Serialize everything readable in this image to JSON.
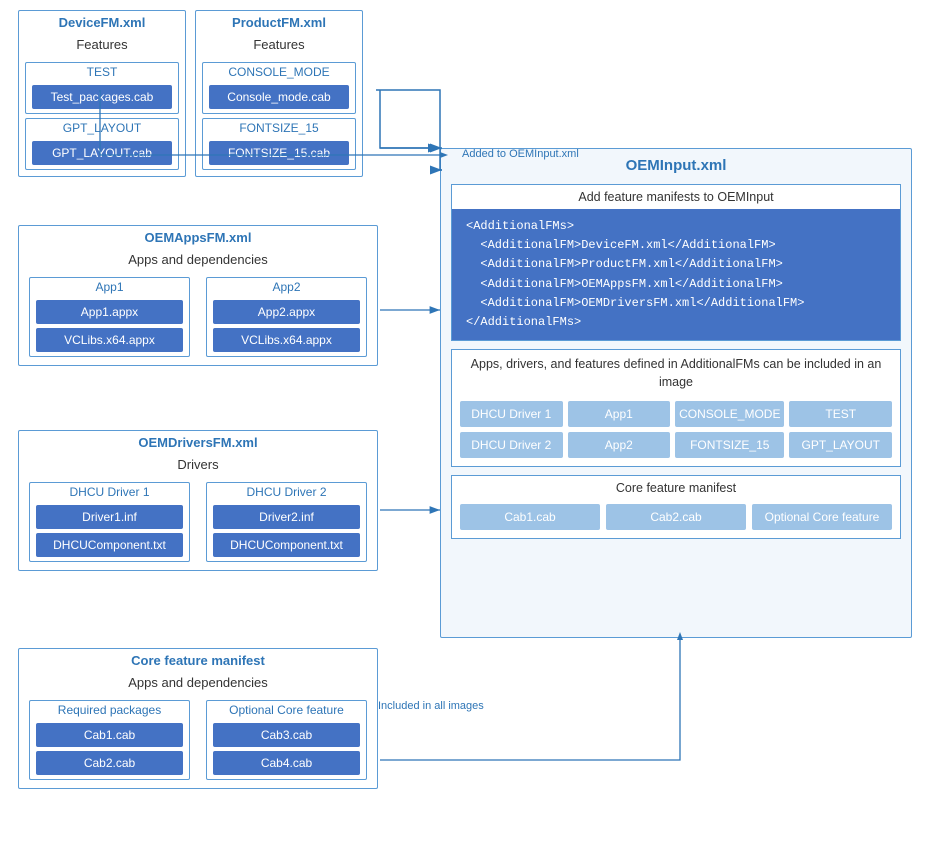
{
  "deviceFM": {
    "title": "DeviceFM.xml",
    "section": "Features",
    "items": [
      {
        "group": "TEST",
        "file": "Test_packages.cab"
      },
      {
        "group": "GPT_LAYOUT",
        "file": "GPT_LAYOUT.cab"
      }
    ]
  },
  "productFM": {
    "title": "ProductFM.xml",
    "section": "Features",
    "items": [
      {
        "group": "CONSOLE_MODE",
        "file": "Console_mode.cab"
      },
      {
        "group": "FONTSIZE_15",
        "file": "FONTSIZE_15.cab"
      }
    ]
  },
  "oemAppsFM": {
    "title": "OEMAppsFM.xml",
    "section": "Apps and dependencies",
    "col1": {
      "group": "App1",
      "files": [
        "App1.appx",
        "VCLibs.x64.appx"
      ]
    },
    "col2": {
      "group": "App2",
      "files": [
        "App2.appx",
        "VCLibs.x64.appx"
      ]
    }
  },
  "oemDriversFM": {
    "title": "OEMDriversFM.xml",
    "section": "Drivers",
    "col1": {
      "group": "DHCU Driver 1",
      "files": [
        "Driver1.inf",
        "DHCUComponent.txt"
      ]
    },
    "col2": {
      "group": "DHCU Driver 2",
      "files": [
        "Driver2.inf",
        "DHCUComponent.txt"
      ]
    }
  },
  "coreFeature": {
    "title": "Core feature manifest",
    "section": "Apps and dependencies",
    "col1": {
      "group": "Required packages",
      "files": [
        "Cab1.cab",
        "Cab2.cab"
      ]
    },
    "col2": {
      "group": "Optional Core feature",
      "files": [
        "Cab3.cab",
        "Cab4.cab"
      ]
    }
  },
  "oemInput": {
    "title": "OEMInput.xml",
    "addFeatureTitle": "Add feature manifests to OEMInput",
    "xmlCode": [
      "<AdditionalFMs>",
      "  <AdditionalFM>DeviceFM.xml</AdditionalFM>",
      "  <AdditionalFM>ProductFM.xml</AdditionalFM>",
      "  <AdditionalFM>OEMAppsFM.xml</AdditionalFM>",
      "  <AdditionalFM>OEMDriversFM.xml</AdditionalFM>",
      "</AdditionalFMs>"
    ],
    "appsDriversTitle": "Apps, drivers, and features defined in AdditionalFMs can be included in an image",
    "gridItems": [
      "DHCU Driver 1",
      "App1",
      "CONSOLE_MODE",
      "TEST",
      "DHCU Driver 2",
      "App2",
      "FONTSIZE_15",
      "GPT_LAYOUT"
    ],
    "coreManifestTitle": "Core feature manifest",
    "coreItems": [
      "Cab1.cab",
      "Cab2.cab",
      "Optional Core feature"
    ]
  },
  "arrows": {
    "addedToLabel": "Added to OEMInput.xml",
    "includedInLabel": "Included in all images"
  }
}
